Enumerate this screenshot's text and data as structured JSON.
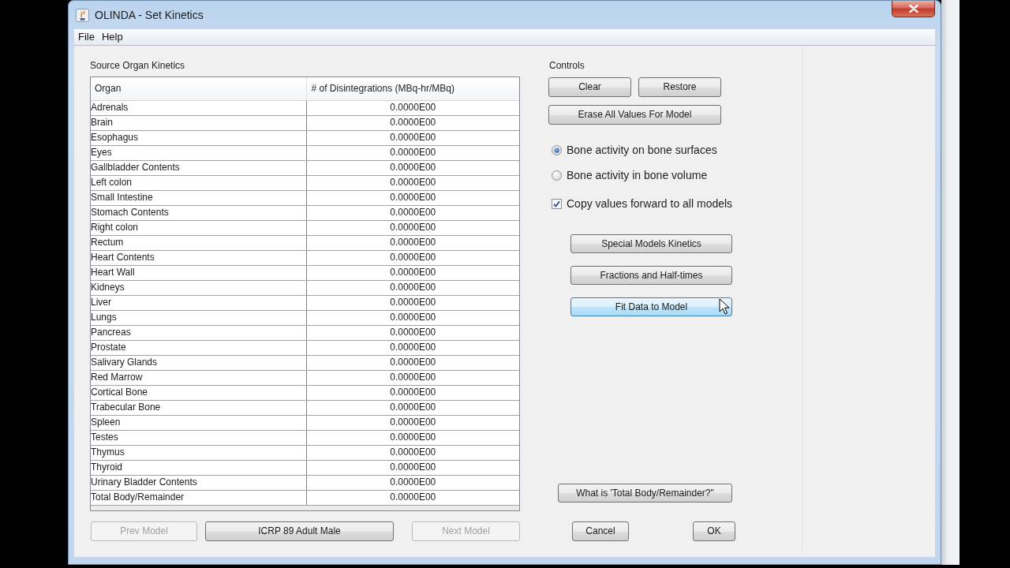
{
  "window": {
    "title": "OLINDA - Set Kinetics"
  },
  "menu": [
    {
      "label": "File"
    },
    {
      "label": "Help"
    }
  ],
  "source_organ_kinetics": {
    "title": "Source Organ Kinetics",
    "columns": [
      "Organ",
      "# of Disintegrations (MBq-hr/MBq)"
    ],
    "rows": [
      {
        "organ": "Adrenals",
        "disintegrations": "0.0000E00"
      },
      {
        "organ": "Brain",
        "disintegrations": "0.0000E00"
      },
      {
        "organ": "Esophagus",
        "disintegrations": "0.0000E00"
      },
      {
        "organ": "Eyes",
        "disintegrations": "0.0000E00"
      },
      {
        "organ": "Gallbladder Contents",
        "disintegrations": "0.0000E00"
      },
      {
        "organ": "Left colon",
        "disintegrations": "0.0000E00"
      },
      {
        "organ": "Small Intestine",
        "disintegrations": "0.0000E00"
      },
      {
        "organ": "Stomach Contents",
        "disintegrations": "0.0000E00"
      },
      {
        "organ": "Right colon",
        "disintegrations": "0.0000E00"
      },
      {
        "organ": "Rectum",
        "disintegrations": "0.0000E00"
      },
      {
        "organ": "Heart Contents",
        "disintegrations": "0.0000E00"
      },
      {
        "organ": "Heart Wall",
        "disintegrations": "0.0000E00"
      },
      {
        "organ": "Kidneys",
        "disintegrations": "0.0000E00"
      },
      {
        "organ": "Liver",
        "disintegrations": "0.0000E00"
      },
      {
        "organ": "Lungs",
        "disintegrations": "0.0000E00"
      },
      {
        "organ": "Pancreas",
        "disintegrations": "0.0000E00"
      },
      {
        "organ": "Prostate",
        "disintegrations": "0.0000E00"
      },
      {
        "organ": "Salivary Glands",
        "disintegrations": "0.0000E00"
      },
      {
        "organ": "Red Marrow",
        "disintegrations": "0.0000E00"
      },
      {
        "organ": "Cortical Bone",
        "disintegrations": "0.0000E00"
      },
      {
        "organ": "Trabecular Bone",
        "disintegrations": "0.0000E00"
      },
      {
        "organ": "Spleen",
        "disintegrations": "0.0000E00"
      },
      {
        "organ": "Testes",
        "disintegrations": "0.0000E00"
      },
      {
        "organ": "Thymus",
        "disintegrations": "0.0000E00"
      },
      {
        "organ": "Thyroid",
        "disintegrations": "0.0000E00"
      },
      {
        "organ": "Urinary Bladder Contents",
        "disintegrations": "0.0000E00"
      },
      {
        "organ": "Total Body/Remainder",
        "disintegrations": "0.0000E00"
      }
    ]
  },
  "model_navigation": [
    {
      "label": "Prev Model",
      "disabled": true
    },
    {
      "label": "ICRP 89 Adult Male",
      "disabled": false
    },
    {
      "label": "Next Model",
      "disabled": true
    }
  ],
  "controls": {
    "title": "Controls",
    "edit_buttons": [
      {
        "label": "Clear"
      },
      {
        "label": "Restore"
      },
      {
        "label": "Erase All Values For Model"
      }
    ],
    "bone_activity": [
      {
        "label": "Bone activity on bone surfaces",
        "selected": true
      },
      {
        "label": "Bone activity in bone volume",
        "selected": false
      }
    ],
    "copy_forward": {
      "label": "Copy values forward to all models",
      "checked": true
    },
    "model_buttons": [
      {
        "label": "Special Models Kinetics",
        "hovered": false
      },
      {
        "label": "Fractions and Half-times",
        "hovered": false
      },
      {
        "label": "Fit Data to Model",
        "hovered": true
      }
    ],
    "help_button": {
      "label": "What is 'Total Body/Remainder?\""
    },
    "dialog_buttons": [
      {
        "label": "Cancel"
      },
      {
        "label": "OK"
      }
    ]
  }
}
